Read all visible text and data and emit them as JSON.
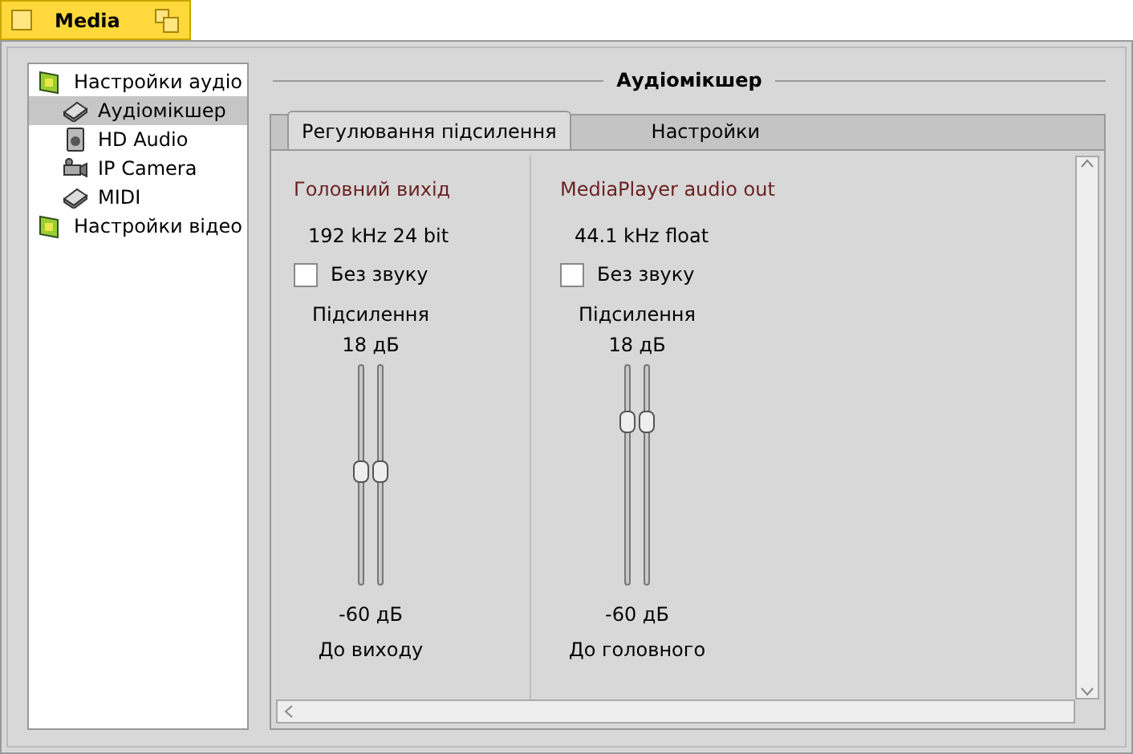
{
  "window": {
    "title": "Media"
  },
  "sidebar": {
    "items": [
      {
        "label": "Настройки аудіо",
        "selected": false,
        "children": [
          {
            "label": "Аудіомікшер",
            "selected": true
          },
          {
            "label": "HD Audio",
            "selected": false
          },
          {
            "label": "IP Camera",
            "selected": false
          },
          {
            "label": "MIDI",
            "selected": false
          }
        ]
      },
      {
        "label": "Настройки відео",
        "selected": false
      }
    ]
  },
  "header": "Аудіомікшер",
  "tabs": [
    {
      "label": "Регулювання підсилення",
      "selected": true
    },
    {
      "label": "Настройки",
      "selected": false
    }
  ],
  "channels": [
    {
      "name": "Головний вихід",
      "format": "192 kHz 24 bit",
      "mute": {
        "label": "Без звуку",
        "checked": false
      },
      "gain_label": "Підсилення",
      "max": "18 дБ",
      "min": "-60 дБ",
      "sliders": [
        {
          "level": 0.52
        },
        {
          "level": 0.52
        }
      ],
      "output": "До виходу"
    },
    {
      "name": "MediaPlayer audio out",
      "format": "44.1 kHz float",
      "mute": {
        "label": "Без звуку",
        "checked": false
      },
      "gain_label": "Підсилення",
      "max": "18 дБ",
      "min": "-60 дБ",
      "sliders": [
        {
          "level": 0.77
        },
        {
          "level": 0.77
        }
      ],
      "output": "До головного"
    }
  ]
}
